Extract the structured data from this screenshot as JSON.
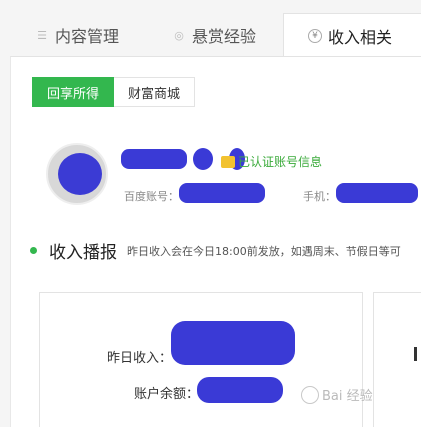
{
  "tabs": [
    {
      "label": "内容管理",
      "icon": "list-icon"
    },
    {
      "label": "悬赏经验",
      "icon": "reward-icon"
    },
    {
      "label": "收入相关",
      "icon": "yen-icon",
      "active": true
    }
  ],
  "subtabs": [
    {
      "label": "回享所得",
      "active": true
    },
    {
      "label": "财富商城",
      "active": false
    }
  ],
  "profile": {
    "verified_text": "已认证账号信息",
    "baidu_account_label": "百度账号：",
    "phone_label": "手机："
  },
  "broadcast": {
    "title": "收入播报",
    "note": "昨日收入会在今日18:00前发放，如遇周末、节假日等可"
  },
  "income": {
    "yesterday_label": "昨日收入：",
    "balance_label": "账户余额："
  },
  "watermark": {
    "text": "Bai 经验"
  },
  "colors": {
    "accent_green": "#33b74e",
    "redaction_blue": "#3a3ad6"
  }
}
